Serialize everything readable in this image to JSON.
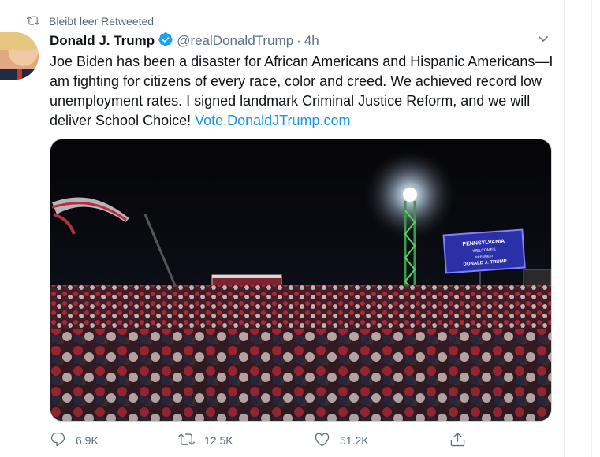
{
  "social_context": {
    "text": "Bleibt leer Retweeted",
    "icon": "retweet-icon"
  },
  "tweet": {
    "display_name": "Donald J. Trump",
    "handle": "@realDonaldTrump",
    "separator": "·",
    "time": "4h",
    "text_before_link": "Joe Biden has been a disaster for African Americans and Hispanic Americans—I am fighting for citizens of every race, color and creed. We achieved record low unemployment rates. I signed landmark Criminal Justice Reform, and we will deliver School Choice! ",
    "link": "Vote.DonaldJTrump.com",
    "media_screen_lines": [
      "PENNSYLVANIA",
      "WELCOMES",
      "PRESIDENT",
      "DONALD J. TRUMP"
    ]
  },
  "actions": {
    "reply_count": "6.9K",
    "retweet_count": "12.5K",
    "like_count": "51.2K"
  },
  "colors": {
    "link": "#1b95e0",
    "muted": "#5b7083",
    "verified": "#1da1f2"
  }
}
